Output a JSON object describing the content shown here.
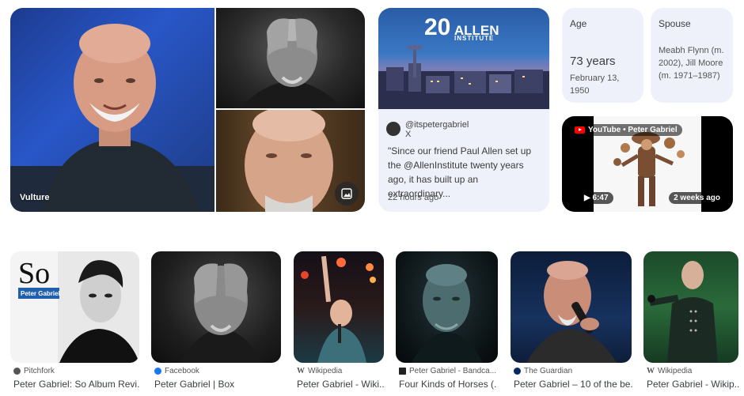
{
  "hero": {
    "source": "Vulture"
  },
  "tweet": {
    "handle": "@itspetergabriel",
    "platform": "X",
    "text": "\"Since our friend Paul Allen set up the @AllenInstitute twenty years ago, it has built up an extraordinary...",
    "time": "22 hours ago",
    "logo_text": "ALLEN",
    "logo_sub": "INSTITUTE"
  },
  "age": {
    "label": "Age",
    "value": "73 years",
    "birth": "February 13, 1950"
  },
  "spouse": {
    "label": "Spouse",
    "value": "Meabh Flynn (m. 2002), Jill Moore (m. 1971–1987)"
  },
  "video": {
    "channel": "YouTube • Peter Gabriel",
    "duration": "6:47",
    "age": "2 weeks ago"
  },
  "results": [
    {
      "source": "Pitchfork",
      "caption": "Peter Gabriel: So Album Revi...",
      "album_title": "So",
      "album_artist": "Peter Gabriel"
    },
    {
      "source": "Facebook",
      "caption": "Peter Gabriel | Box"
    },
    {
      "source": "Wikipedia",
      "caption": "Peter Gabriel - Wiki..."
    },
    {
      "source": "Peter Gabriel - Bandca...",
      "caption": "Four Kinds of Horses (..."
    },
    {
      "source": "The Guardian",
      "caption": "Peter Gabriel – 10 of the be..."
    },
    {
      "source": "Wikipedia",
      "caption": "Peter Gabriel - Wikip..."
    }
  ],
  "colors": {
    "card_bg": "#eef0fa",
    "youtube_red": "#ff0000"
  }
}
